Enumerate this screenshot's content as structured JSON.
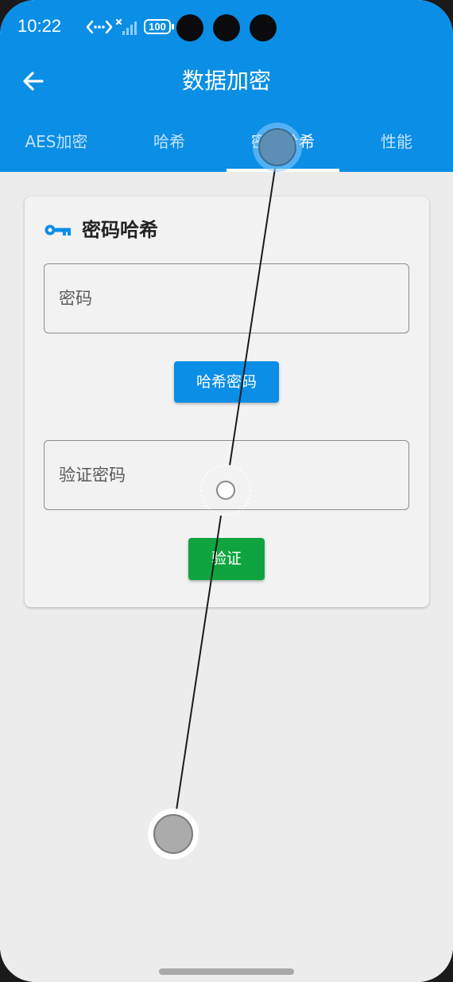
{
  "status_bar": {
    "time": "10:22",
    "battery": "100",
    "network_icon": "data-transfer-icon",
    "signal_icon": "no-signal-icon"
  },
  "app_bar": {
    "title": "数据加密",
    "back_icon": "arrow-back-icon",
    "color": "#0a8ee6"
  },
  "tabs": [
    {
      "label": "AES加密",
      "active": false
    },
    {
      "label": "哈希",
      "active": false
    },
    {
      "label": "密码哈希",
      "active": true
    },
    {
      "label": "性能",
      "active": false
    }
  ],
  "card": {
    "icon": "key-icon",
    "title": "密码哈希",
    "password_field": {
      "placeholder": "密码",
      "value": ""
    },
    "hash_button": {
      "label": "哈希密码",
      "color": "#0a8ee6"
    },
    "verify_field": {
      "placeholder": "验证密码",
      "value": ""
    },
    "verify_button": {
      "label": "验证",
      "color": "#0fa43f"
    }
  }
}
